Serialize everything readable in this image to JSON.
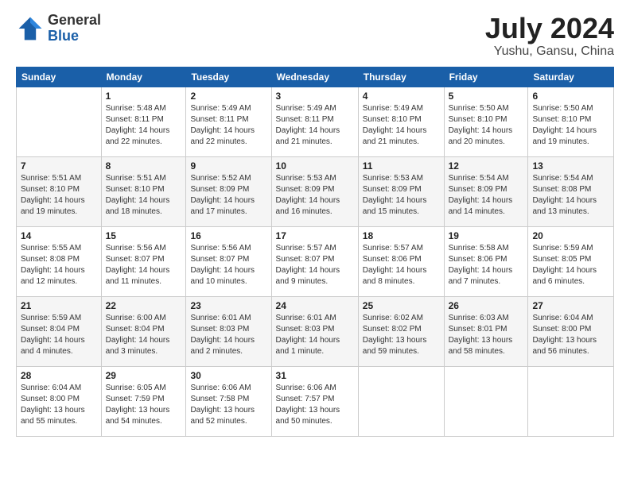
{
  "logo": {
    "general": "General",
    "blue": "Blue"
  },
  "title": "July 2024",
  "location": "Yushu, Gansu, China",
  "weekdays": [
    "Sunday",
    "Monday",
    "Tuesday",
    "Wednesday",
    "Thursday",
    "Friday",
    "Saturday"
  ],
  "weeks": [
    [
      {
        "day": "",
        "info": ""
      },
      {
        "day": "1",
        "info": "Sunrise: 5:48 AM\nSunset: 8:11 PM\nDaylight: 14 hours\nand 22 minutes."
      },
      {
        "day": "2",
        "info": "Sunrise: 5:49 AM\nSunset: 8:11 PM\nDaylight: 14 hours\nand 22 minutes."
      },
      {
        "day": "3",
        "info": "Sunrise: 5:49 AM\nSunset: 8:11 PM\nDaylight: 14 hours\nand 21 minutes."
      },
      {
        "day": "4",
        "info": "Sunrise: 5:49 AM\nSunset: 8:10 PM\nDaylight: 14 hours\nand 21 minutes."
      },
      {
        "day": "5",
        "info": "Sunrise: 5:50 AM\nSunset: 8:10 PM\nDaylight: 14 hours\nand 20 minutes."
      },
      {
        "day": "6",
        "info": "Sunrise: 5:50 AM\nSunset: 8:10 PM\nDaylight: 14 hours\nand 19 minutes."
      }
    ],
    [
      {
        "day": "7",
        "info": "Sunrise: 5:51 AM\nSunset: 8:10 PM\nDaylight: 14 hours\nand 19 minutes."
      },
      {
        "day": "8",
        "info": "Sunrise: 5:51 AM\nSunset: 8:10 PM\nDaylight: 14 hours\nand 18 minutes."
      },
      {
        "day": "9",
        "info": "Sunrise: 5:52 AM\nSunset: 8:09 PM\nDaylight: 14 hours\nand 17 minutes."
      },
      {
        "day": "10",
        "info": "Sunrise: 5:53 AM\nSunset: 8:09 PM\nDaylight: 14 hours\nand 16 minutes."
      },
      {
        "day": "11",
        "info": "Sunrise: 5:53 AM\nSunset: 8:09 PM\nDaylight: 14 hours\nand 15 minutes."
      },
      {
        "day": "12",
        "info": "Sunrise: 5:54 AM\nSunset: 8:09 PM\nDaylight: 14 hours\nand 14 minutes."
      },
      {
        "day": "13",
        "info": "Sunrise: 5:54 AM\nSunset: 8:08 PM\nDaylight: 14 hours\nand 13 minutes."
      }
    ],
    [
      {
        "day": "14",
        "info": "Sunrise: 5:55 AM\nSunset: 8:08 PM\nDaylight: 14 hours\nand 12 minutes."
      },
      {
        "day": "15",
        "info": "Sunrise: 5:56 AM\nSunset: 8:07 PM\nDaylight: 14 hours\nand 11 minutes."
      },
      {
        "day": "16",
        "info": "Sunrise: 5:56 AM\nSunset: 8:07 PM\nDaylight: 14 hours\nand 10 minutes."
      },
      {
        "day": "17",
        "info": "Sunrise: 5:57 AM\nSunset: 8:07 PM\nDaylight: 14 hours\nand 9 minutes."
      },
      {
        "day": "18",
        "info": "Sunrise: 5:57 AM\nSunset: 8:06 PM\nDaylight: 14 hours\nand 8 minutes."
      },
      {
        "day": "19",
        "info": "Sunrise: 5:58 AM\nSunset: 8:06 PM\nDaylight: 14 hours\nand 7 minutes."
      },
      {
        "day": "20",
        "info": "Sunrise: 5:59 AM\nSunset: 8:05 PM\nDaylight: 14 hours\nand 6 minutes."
      }
    ],
    [
      {
        "day": "21",
        "info": "Sunrise: 5:59 AM\nSunset: 8:04 PM\nDaylight: 14 hours\nand 4 minutes."
      },
      {
        "day": "22",
        "info": "Sunrise: 6:00 AM\nSunset: 8:04 PM\nDaylight: 14 hours\nand 3 minutes."
      },
      {
        "day": "23",
        "info": "Sunrise: 6:01 AM\nSunset: 8:03 PM\nDaylight: 14 hours\nand 2 minutes."
      },
      {
        "day": "24",
        "info": "Sunrise: 6:01 AM\nSunset: 8:03 PM\nDaylight: 14 hours\nand 1 minute."
      },
      {
        "day": "25",
        "info": "Sunrise: 6:02 AM\nSunset: 8:02 PM\nDaylight: 13 hours\nand 59 minutes."
      },
      {
        "day": "26",
        "info": "Sunrise: 6:03 AM\nSunset: 8:01 PM\nDaylight: 13 hours\nand 58 minutes."
      },
      {
        "day": "27",
        "info": "Sunrise: 6:04 AM\nSunset: 8:00 PM\nDaylight: 13 hours\nand 56 minutes."
      }
    ],
    [
      {
        "day": "28",
        "info": "Sunrise: 6:04 AM\nSunset: 8:00 PM\nDaylight: 13 hours\nand 55 minutes."
      },
      {
        "day": "29",
        "info": "Sunrise: 6:05 AM\nSunset: 7:59 PM\nDaylight: 13 hours\nand 54 minutes."
      },
      {
        "day": "30",
        "info": "Sunrise: 6:06 AM\nSunset: 7:58 PM\nDaylight: 13 hours\nand 52 minutes."
      },
      {
        "day": "31",
        "info": "Sunrise: 6:06 AM\nSunset: 7:57 PM\nDaylight: 13 hours\nand 50 minutes."
      },
      {
        "day": "",
        "info": ""
      },
      {
        "day": "",
        "info": ""
      },
      {
        "day": "",
        "info": ""
      }
    ]
  ]
}
